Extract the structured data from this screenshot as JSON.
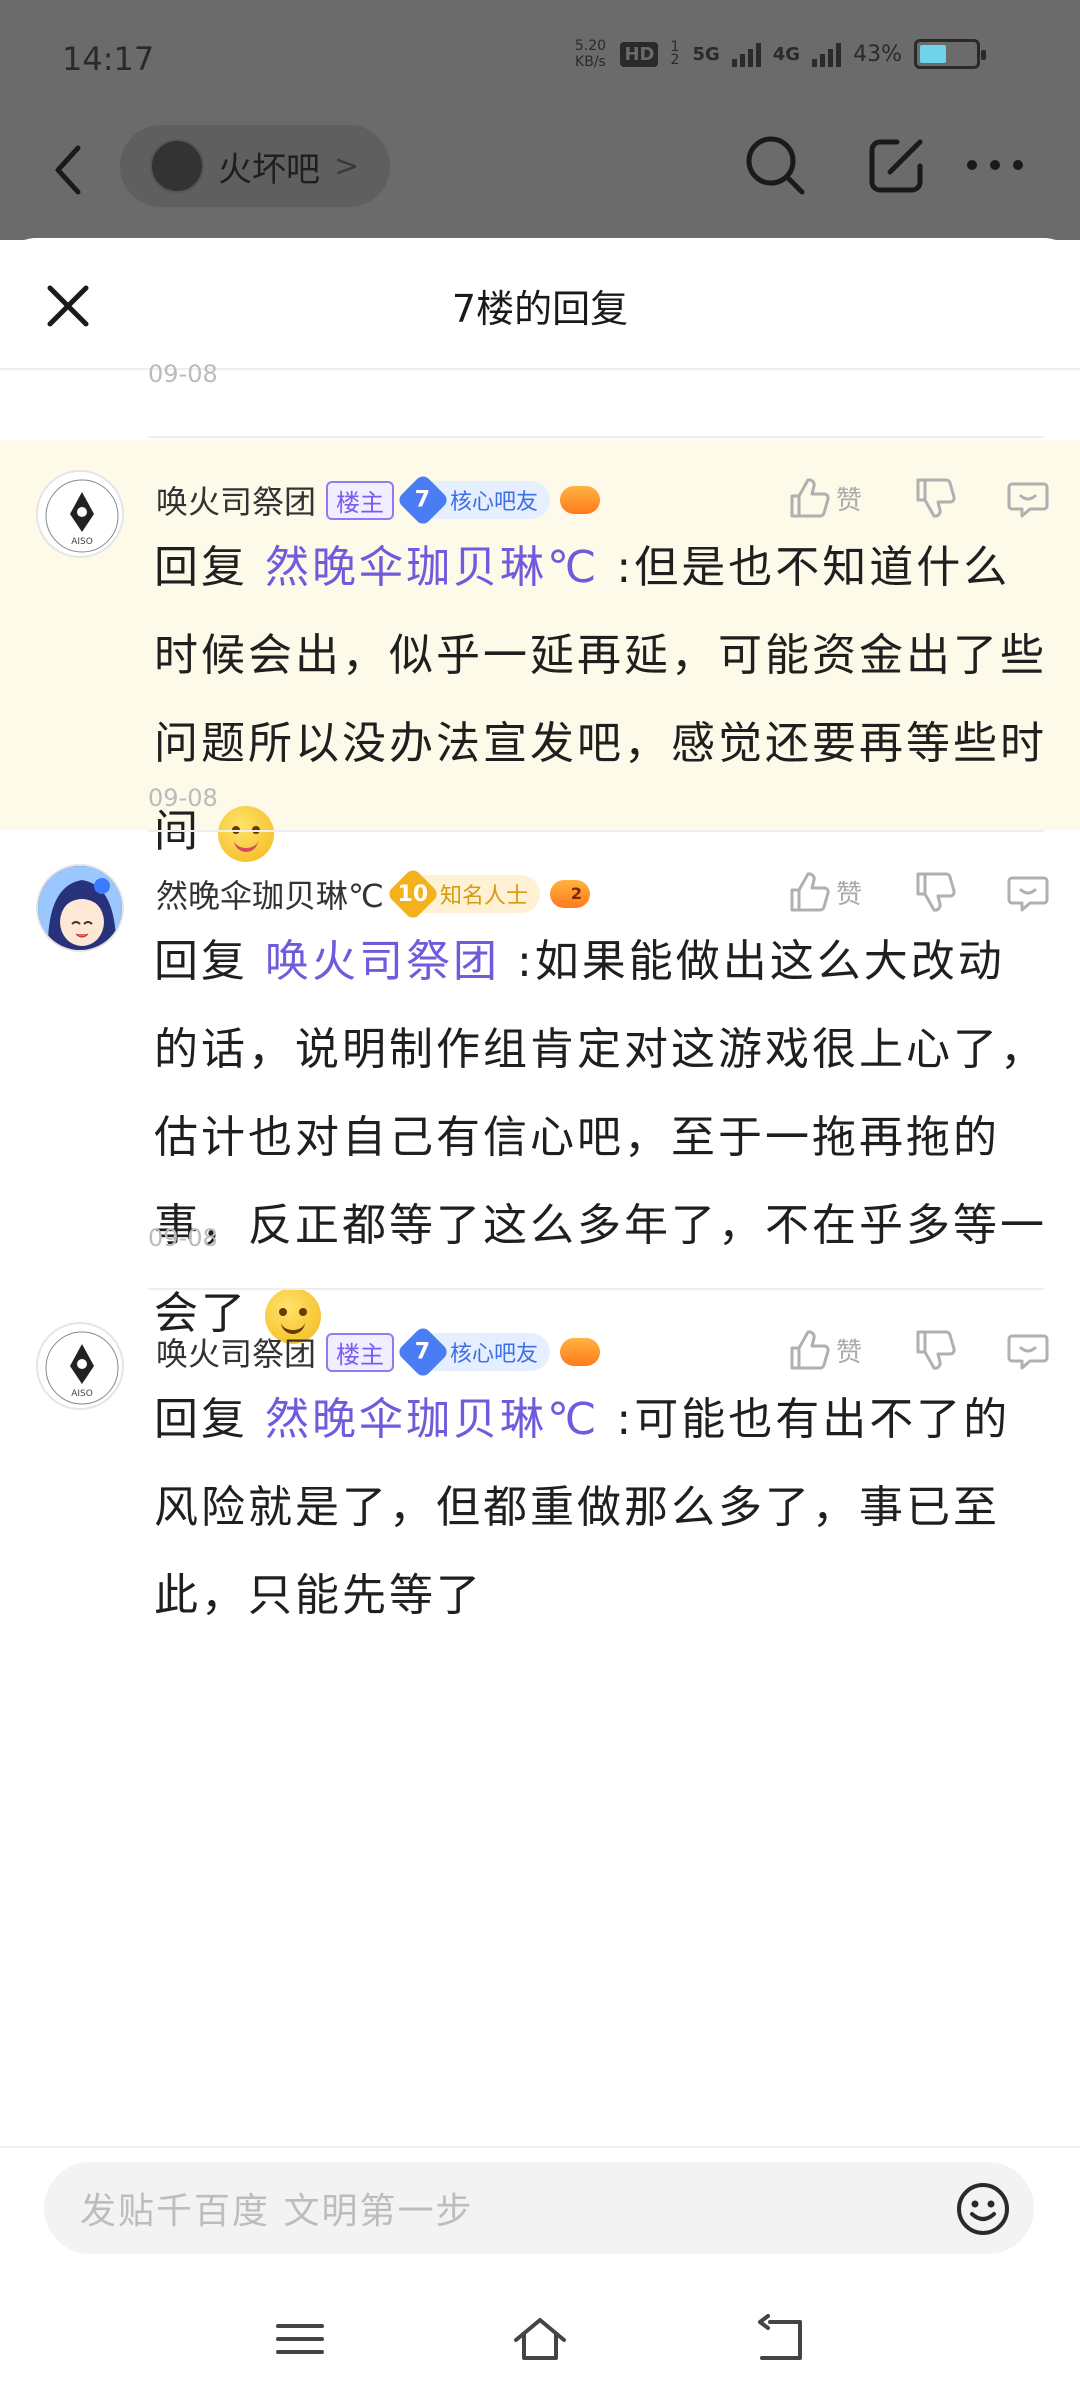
{
  "status_bar": {
    "time": "14:17",
    "net_speed": "5.20",
    "net_unit": "KB/s",
    "hd_badge": "HD",
    "hd_sub": "1 2",
    "net1": "5G",
    "net2": "4G",
    "battery": "43%"
  },
  "top_nav": {
    "forum_name": "火坏吧",
    "forum_chevron": ">"
  },
  "sheet": {
    "title": "7楼的回复",
    "prev_date": "09-08"
  },
  "replies": [
    {
      "username": "唤火司祭团",
      "owner_tag": "楼主",
      "level": "7",
      "level_title": "核心吧友",
      "like_label": "赞",
      "reply_prefix": "回复",
      "reply_to": "然晚伞珈贝琳℃",
      "text": " :但是也不知道什么时候会出，似乎一延再延，可能资金出了些问题所以没办法宣发吧，感觉还要再等些时间",
      "date": "09-08"
    },
    {
      "username": "然晚伞珈贝琳℃",
      "level": "10",
      "level_title": "知名人士",
      "badge_num": "2",
      "like_label": "赞",
      "reply_prefix": "回复",
      "reply_to": "唤火司祭团",
      "text": " :如果能做出这么大改动的话，说明制作组肯定对这游戏很上心了，估计也对自己有信心吧，至于一拖再拖的事，反正都等了这么多年了，不在乎多等一会了",
      "date": "09-08"
    },
    {
      "username": "唤火司祭团",
      "owner_tag": "楼主",
      "level": "7",
      "level_title": "核心吧友",
      "like_label": "赞",
      "reply_prefix": "回复",
      "reply_to": "然晚伞珈贝琳℃",
      "text": " :可能也有出不了的风险就是了，但都重做那么多了，事已至此，只能先等了"
    }
  ],
  "composer": {
    "placeholder": "发贴千百度 文明第一步"
  },
  "colors": {
    "highlight_bg": "#fdfaea",
    "mention": "#6f5bdc",
    "level_blue": "#4a7cf3",
    "level_gold": "#f3b21c"
  }
}
